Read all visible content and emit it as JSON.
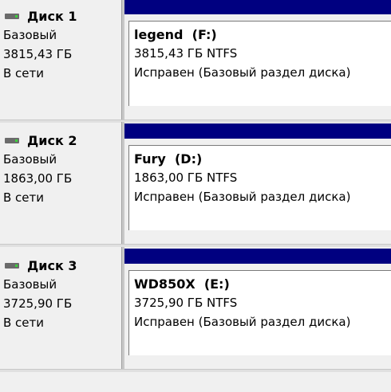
{
  "disks": [
    {
      "name": "Диск 1",
      "type": "Базовый",
      "size": "3815,43 ГБ",
      "state": "В сети",
      "volume": {
        "label": "legend",
        "letter": "(F:)",
        "size_fs": "3815,43 ГБ NTFS",
        "status": "Исправен (Базовый раздел диска)"
      }
    },
    {
      "name": "Диск 2",
      "type": "Базовый",
      "size": "1863,00 ГБ",
      "state": "В сети",
      "volume": {
        "label": "Fury",
        "letter": "(D:)",
        "size_fs": "1863,00 ГБ NTFS",
        "status": "Исправен (Базовый раздел диска)"
      }
    },
    {
      "name": "Диск 3",
      "type": "Базовый",
      "size": "3725,90 ГБ",
      "state": "В сети",
      "volume": {
        "label": "WD850X",
        "letter": "(E:)",
        "size_fs": "3725,90 ГБ NTFS",
        "status": "Исправен (Базовый раздел диска)"
      }
    }
  ],
  "colors": {
    "volume_bar": "#000080",
    "background": "#f0f0f0",
    "disk_icon": "#6b6b6b",
    "disk_led": "#3cd13c"
  },
  "icons": {
    "disk": "hard-disk-icon"
  }
}
